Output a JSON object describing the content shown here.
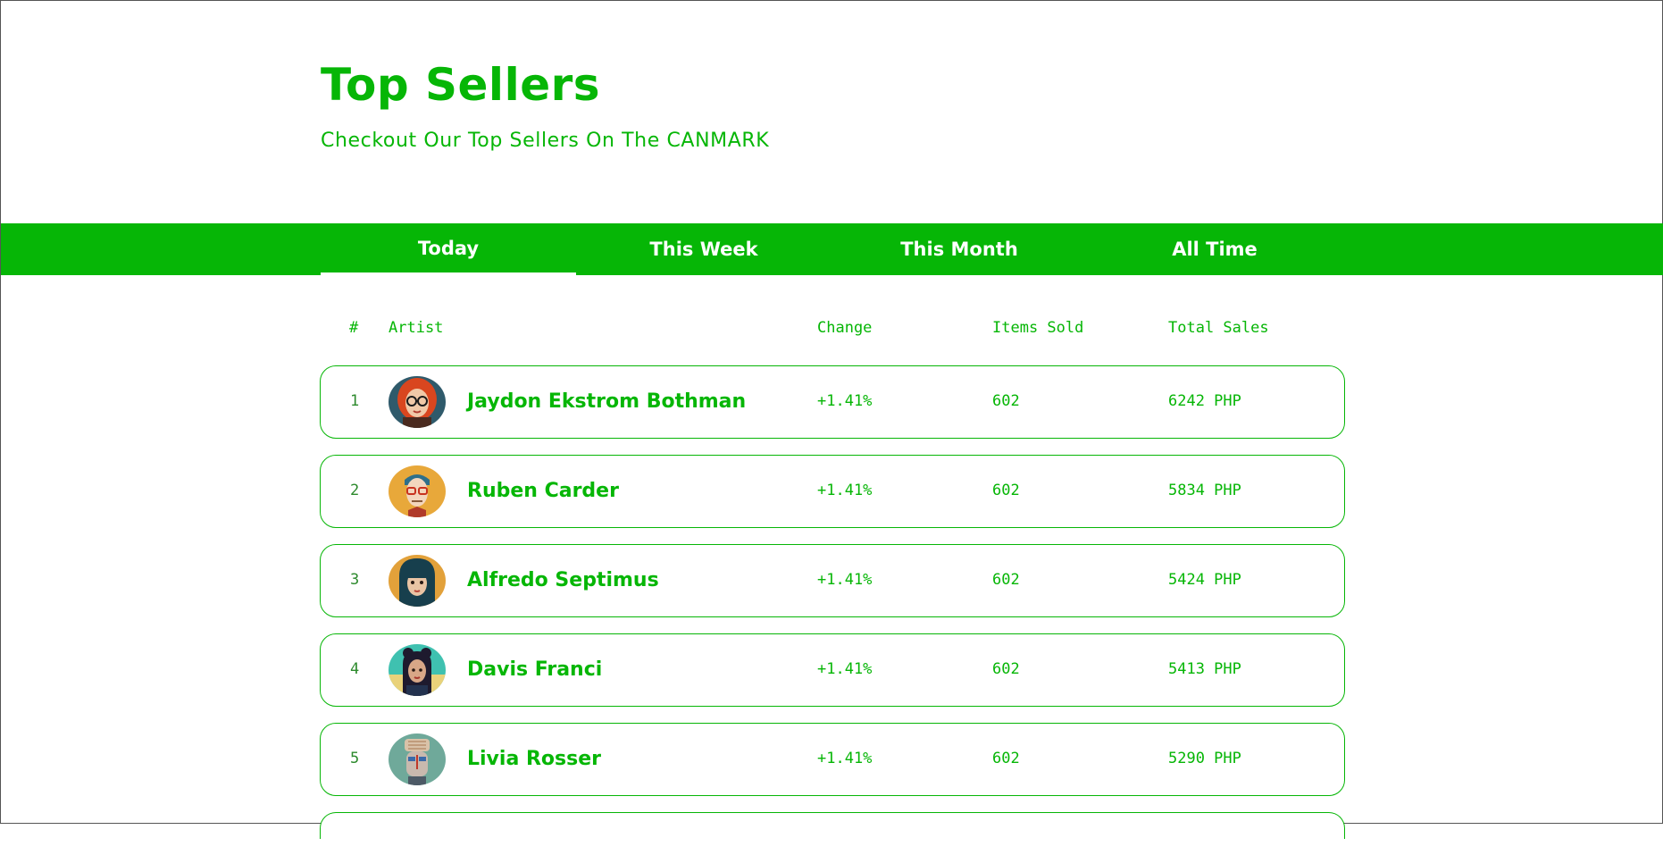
{
  "header": {
    "title": "Top Sellers",
    "subtitle": "Checkout Our Top Sellers On The CANMARK"
  },
  "tabs": [
    {
      "label": "Today",
      "active": true
    },
    {
      "label": "This Week",
      "active": false
    },
    {
      "label": "This Month",
      "active": false
    },
    {
      "label": "All Time",
      "active": false
    }
  ],
  "table": {
    "columns": {
      "rank": "#",
      "artist": "Artist",
      "change": "Change",
      "items_sold": "Items Sold",
      "total_sales": "Total Sales"
    },
    "rows": [
      {
        "rank": "1",
        "artist": "Jaydon Ekstrom Bothman",
        "change": "+1.41%",
        "items_sold": "602",
        "total_sales": "6242 PHP"
      },
      {
        "rank": "2",
        "artist": "Ruben Carder",
        "change": "+1.41%",
        "items_sold": "602",
        "total_sales": "5834 PHP"
      },
      {
        "rank": "3",
        "artist": "Alfredo Septimus",
        "change": "+1.41%",
        "items_sold": "602",
        "total_sales": "5424 PHP"
      },
      {
        "rank": "4",
        "artist": "Davis Franci",
        "change": "+1.41%",
        "items_sold": "602",
        "total_sales": "5413 PHP"
      },
      {
        "rank": "5",
        "artist": "Livia Rosser",
        "change": "+1.41%",
        "items_sold": "602",
        "total_sales": "5290 PHP"
      }
    ]
  },
  "colors": {
    "accent": "#06b606",
    "background": "#ffffff",
    "tab_text": "#ffffff"
  }
}
